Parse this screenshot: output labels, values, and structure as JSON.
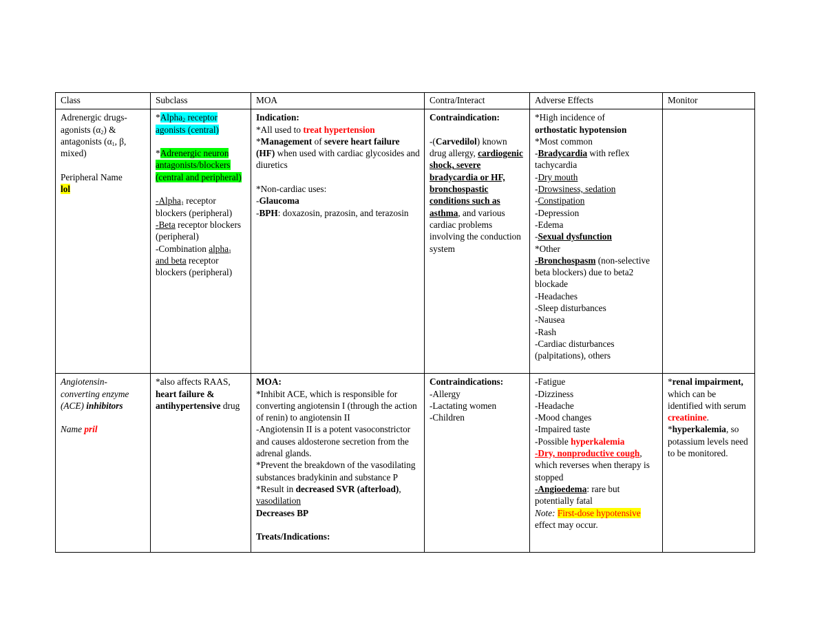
{
  "table": {
    "headers": [
      "Class",
      "Subclass",
      "MOA",
      "Contra/Interact",
      "Adverse Effects",
      "Monitor"
    ],
    "row1": {
      "class": {
        "line1": "Adrenergic drugs-",
        "line2a": "agonists (α",
        "line2sub": "2",
        "line2b": ") &",
        "line3a": "antagonists (α",
        "line3sub": "1",
        "line3b": ", β,",
        "line4": "mixed)",
        "peripheral_name_label": "Peripheral Name",
        "peripheral_name_value": "lol"
      },
      "subclass": {
        "alpha2_star": "*",
        "alpha2_a": "Alpha",
        "alpha2_sub": "2",
        "alpha2_b": " receptor agonists (central)",
        "adrenergic_star": "*",
        "adrenergic_text": "Adrenergic neuron antagonists/blockers (central and peripheral)",
        "alpha1_dash": "-",
        "alpha1_a": "Alpha",
        "alpha1_sub": "1",
        "alpha1_b": " receptor blockers (peripheral)",
        "beta_dash": "-",
        "beta_label": "Beta",
        "beta_rest": " receptor blockers (peripheral)",
        "combo_a": "-Combination ",
        "combo_u1": "alpha",
        "combo_sub": "1",
        "combo_u2": "and beta",
        "combo_b": " receptor blockers (peripheral)"
      },
      "moa": {
        "heading": "Indication:",
        "l1_pre": "*All used to ",
        "l1_red": "treat hypertension",
        "l2_star": "*",
        "l2_b1": "Management",
        "l2_mid": " of ",
        "l2_b2": "severe heart failure (HF)",
        "l2_rest": " when used with cardiac glycosides and diuretics",
        "noncardiac": "*Non-cardiac uses:",
        "glaucoma_dash": "-",
        "glaucoma": "Glaucoma",
        "bph_dash": "-",
        "bph": "BPH",
        "bph_rest": ": doxazosin, prazosin, and terazosin"
      },
      "contra": {
        "heading": "Contraindication:",
        "c_pre": "-(",
        "c_drug": "Carvedilol",
        "c_post": ") known drug allergy, ",
        "c_bu": "cardiogenic shock, severe bradycardia or HF, bronchospastic conditions such as asthma",
        "c_rest": ", and various cardiac problems involving the conduction system"
      },
      "adverse": {
        "l1": "*High incidence of",
        "l2": "orthostatic hypotension",
        "l3": "*Most common",
        "brady_dash": "-",
        "brady": "Bradycardia",
        "brady_rest": " with reflex tachycardia",
        "dry_dash": "-",
        "dry": "Dry mouth",
        "drowsy_dash": "-",
        "drowsy": "Drowsiness, sedation",
        "const_dash": "-",
        "const": "Constipation",
        "depression": "-Depression",
        "edema": "-Edema",
        "sexual_dash": "-",
        "sexual": "Sexual dysfunction",
        "other": "*Other",
        "broncho": "-Bronchospasm",
        "broncho_rest": " (non-selective beta blockers) due to beta2 blockade",
        "headaches": "-Headaches",
        "sleep": "-Sleep disturbances",
        "nausea": "-Nausea",
        "rash": "-Rash",
        "cardiac": "-Cardiac disturbances (palpitations), others"
      },
      "monitor": ""
    },
    "row2": {
      "class": {
        "l1": "Angiotensin-converting enzyme (ACE) ",
        "l1_b": "inhibitors",
        "name_label": "Name ",
        "name_value": "pril"
      },
      "subclass": {
        "pre": "*also affects RAAS, ",
        "bold": "heart failure & antihypertensive",
        "post": " drug"
      },
      "moa": {
        "heading": "MOA:",
        "p1": "*Inhibit ACE, which is responsible for converting angiotensin I (through the action of renin) to angiotensin II",
        "p2": "-Angiotensin II is a potent vasoconstrictor and causes aldosterone secretion from the adrenal glands.",
        "p3": "*Prevent the breakdown of the vasodilating substances bradykinin and substance P",
        "p4_pre": "*Result in ",
        "p4_b": "decreased SVR (afterload)",
        "p4_comma": ", ",
        "p4_u": "vasodilation",
        "p5": "Decreases BP",
        "treats": "Treats/Indications:"
      },
      "contra": {
        "heading": "Contraindications:",
        "items": [
          "-Allergy",
          "-Lactating women",
          "-Children"
        ]
      },
      "adverse": {
        "fatigue": "-Fatigue",
        "dizziness": "-Dizziness",
        "headache": "-Headache",
        "mood": "-Mood changes",
        "taste": "-Impaired taste",
        "hyperk_pre": "-Possible ",
        "hyperk": "hyperkalemia",
        "cough": "-Dry, nonproductive cough",
        "cough_rest": ", which reverses when therapy is stopped",
        "angio": "-Angioedema",
        "angio_rest": ": rare but potentially fatal",
        "note_label": "Note:",
        "note_hl": "First-dose hypotensive",
        "note_rest": " effect may occur."
      },
      "monitor": {
        "star1": "*",
        "renal": "renal impairment,",
        "renal_rest": " which can be identified with serum ",
        "creatinine": "creatinine",
        "period": ".",
        "star2": "*",
        "hyperk": "hyperkalemia",
        "hyperk_rest": ", so potassium levels need to be monitored."
      }
    }
  },
  "colors": {
    "highlight_cyan": "#00ffff",
    "highlight_green": "#00ff00",
    "highlight_yellow": "#ffff00",
    "emphasis_red": "#ff0000"
  }
}
